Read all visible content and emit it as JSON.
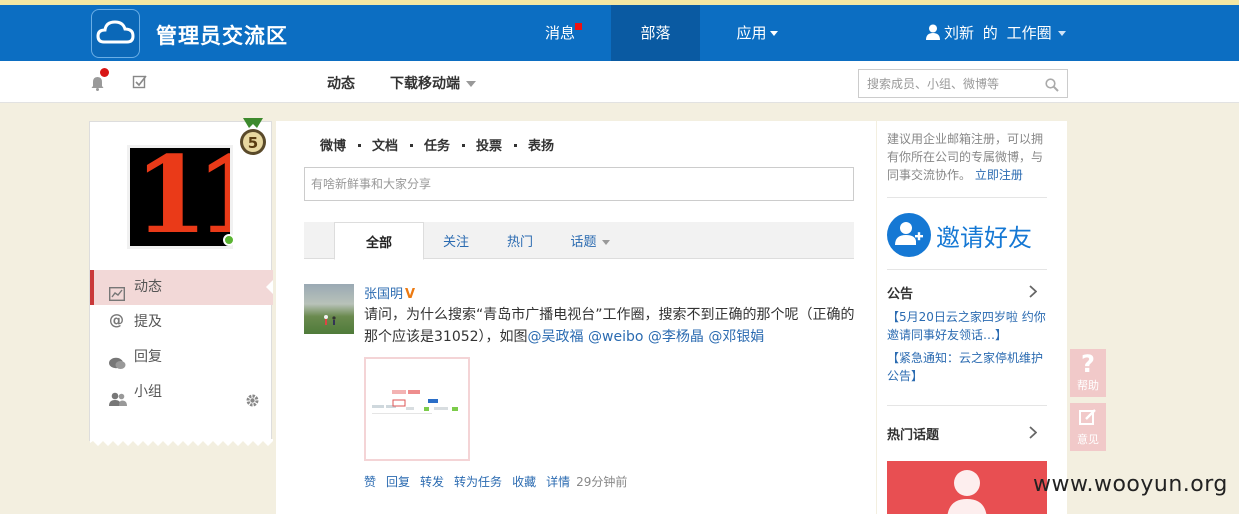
{
  "header": {
    "app_title": "管理员交流区",
    "nav": {
      "messages": "消息",
      "tribe": "部落",
      "apps": "应用"
    },
    "user": {
      "name": "刘新",
      "suffix": "的",
      "workspace": "工作圈"
    }
  },
  "subbar": {
    "feed": "动态",
    "download": "下载移动端",
    "search_placeholder": "搜索成员、小组、微博等"
  },
  "profile": {
    "avatar_text": "11",
    "medal_level": "5"
  },
  "left_menu": [
    {
      "label": "动态"
    },
    {
      "label": "提及"
    },
    {
      "label": "回复"
    },
    {
      "label": "小组"
    }
  ],
  "publisher": {
    "tabs": [
      "微博",
      "文档",
      "任务",
      "投票",
      "表扬"
    ],
    "placeholder": "有啥新鲜事和大家分享"
  },
  "feed_tabs": [
    "全部",
    "关注",
    "热门",
    "话题"
  ],
  "post": {
    "author": "张国明",
    "badge": "V",
    "text_main": "请问，为什么搜索“青岛市广播电视台”工作圈，搜索不到正确的那个呢（正确的那个应该是31052），如图",
    "mentions": [
      "@吴政福",
      "@weibo",
      "@李杨晶",
      "@邓银娟"
    ],
    "actions": [
      "赞",
      "回复",
      "转发",
      "转为任务",
      "收藏",
      "详情"
    ],
    "time": "29分钟前"
  },
  "right": {
    "register_text": "建议用企业邮箱注册，可以拥有你所在公司的专属微博，与同事交流协作。",
    "register_link": "立即注册",
    "invite": "邀请好友",
    "notice_title": "公告",
    "notices": [
      "【5月20日云之家四岁啦 约你邀请同事好友领话…】",
      "【紧急通知：云之家停机维护公告】"
    ],
    "hot_topics_title": "热门话题"
  },
  "float": {
    "help": "帮助",
    "feedback": "意见"
  },
  "watermark": "www.wooyun.org",
  "colors": {
    "brand": "#0c6ec2",
    "link": "#2b6bb1",
    "active_menu": "#f2d8d7",
    "accent_red": "#c9393a"
  }
}
